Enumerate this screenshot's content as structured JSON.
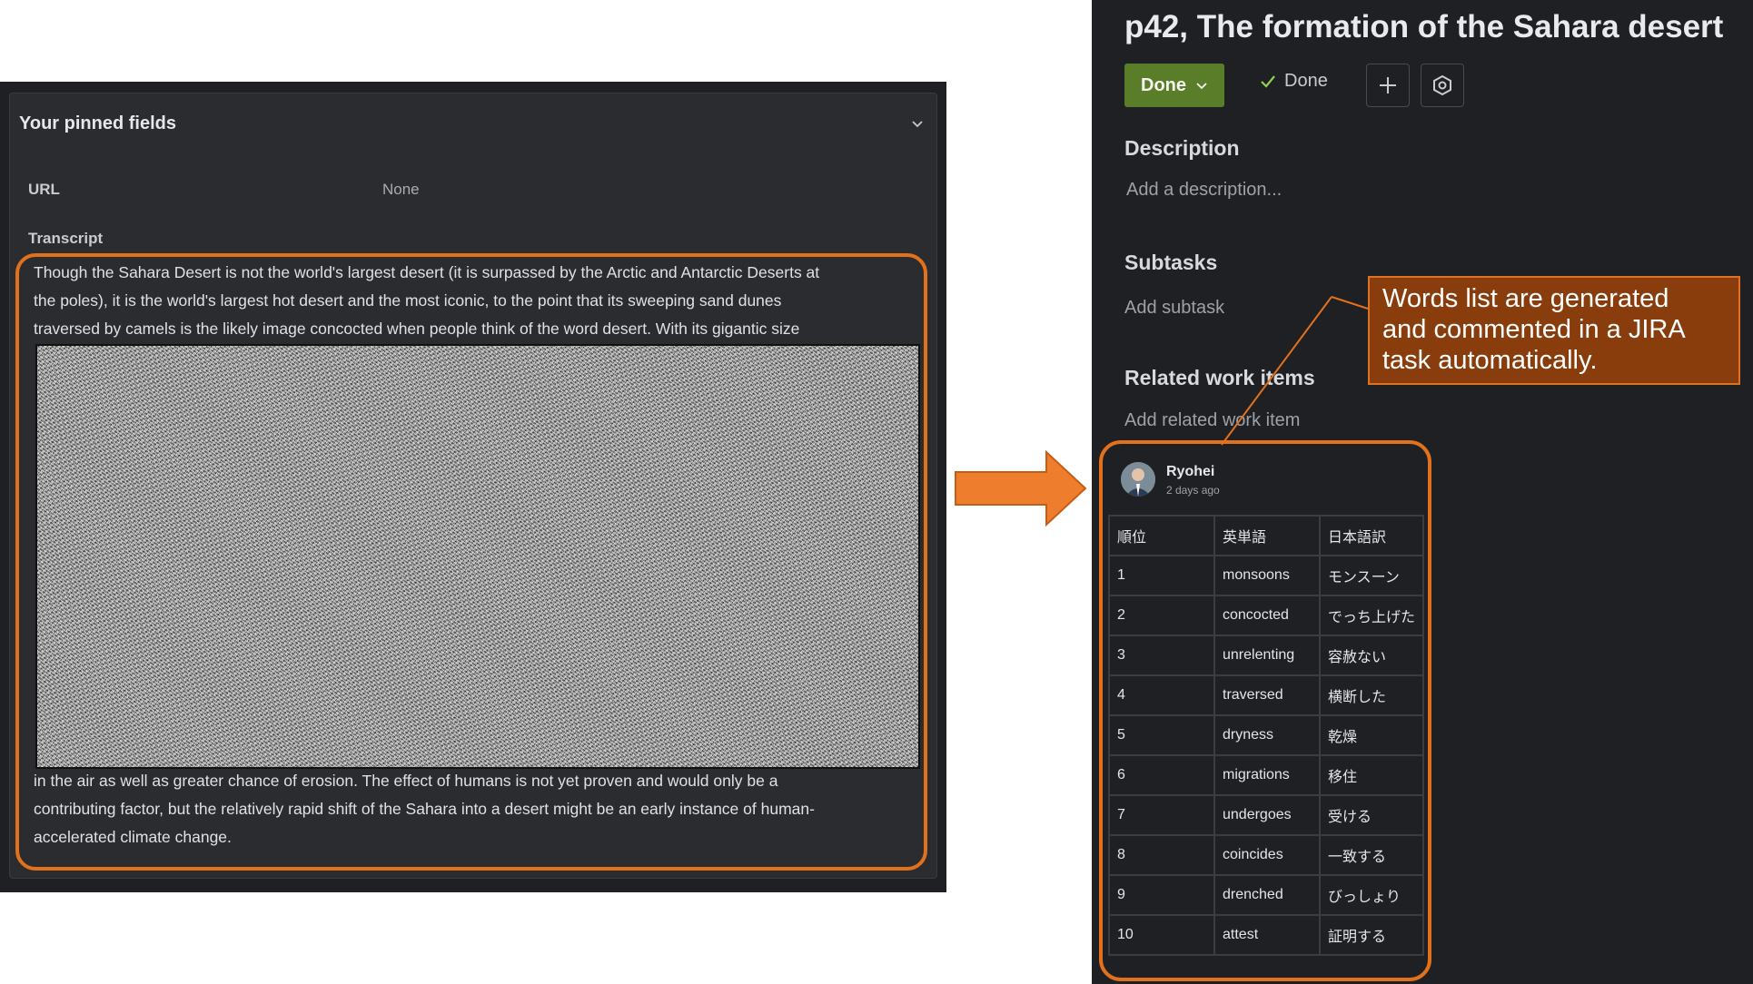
{
  "left": {
    "pinned_title": "Your pinned fields",
    "url_label": "URL",
    "url_value": "None",
    "transcript_label": "Transcript",
    "transcript_top": [
      "Though the Sahara Desert is not the world's largest desert (it is surpassed by the Arctic and Antarctic Deserts at",
      "the poles), it is the world's largest hot desert and the most iconic, to the point that its sweeping sand dunes",
      "traversed by camels is the likely image concocted when people think of the word desert. With its gigantic size"
    ],
    "transcript_bottom": [
      "in the air as well as greater chance of erosion. The effect of humans is not yet proven and would only be a",
      "contributing factor, but the relatively rapid shift of the Sahara into a desert might be an early instance of human-",
      "accelerated climate change."
    ]
  },
  "right": {
    "title": "p42, The formation of the Sahara desert",
    "status_button": "Done",
    "status_indicator": "Done",
    "description_heading": "Description",
    "description_placeholder": "Add a description...",
    "subtasks_heading": "Subtasks",
    "subtasks_placeholder": "Add subtask",
    "related_heading": "Related work items",
    "related_placeholder": "Add related work item",
    "comment": {
      "author": "Ryohei",
      "time": "2 days ago",
      "headers": [
        "順位",
        "英単語",
        "日本語訳"
      ],
      "rows": [
        [
          "1",
          "monsoons",
          "モンスーン"
        ],
        [
          "2",
          "concocted",
          "でっち上げた"
        ],
        [
          "3",
          "unrelenting",
          "容赦ない"
        ],
        [
          "4",
          "traversed",
          "横断した"
        ],
        [
          "5",
          "dryness",
          "乾燥"
        ],
        [
          "6",
          "migrations",
          "移住"
        ],
        [
          "7",
          "undergoes",
          "受ける"
        ],
        [
          "8",
          "coincides",
          "一致する"
        ],
        [
          "9",
          "drenched",
          "びっしょり"
        ],
        [
          "10",
          "attest",
          "証明する"
        ]
      ]
    }
  },
  "callout": {
    "lines": [
      "Words list are generated",
      "and commented in a JIRA",
      "task automatically."
    ]
  },
  "colors": {
    "accent_orange": "#e2711d",
    "status_green": "#5a7d2a",
    "callout_fill": "#8a3d0c"
  }
}
